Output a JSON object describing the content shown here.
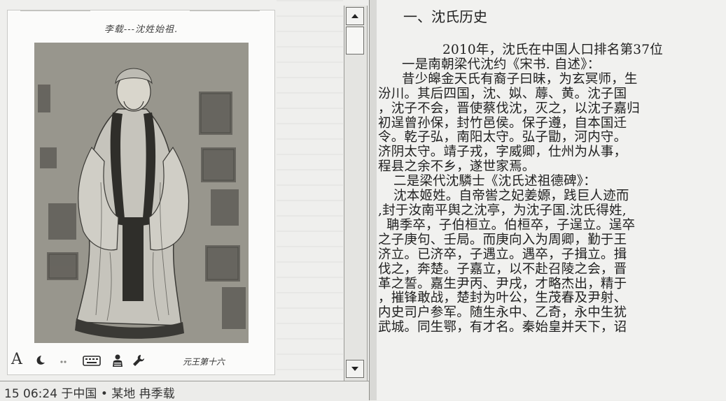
{
  "image_card": {
    "caption": "李载---沈姓始祖.",
    "signature": "元王第十六",
    "tools": {
      "text_tool": "A"
    }
  },
  "article": {
    "heading": "一、沈氏历史",
    "lines": [
      "2010年，沈氏在中国人口排名第37位",
      "一是南朝梁代沈约《宋书. 自述》：",
      "昔少皞金天氏有裔子曰昧，为玄冥师，生",
      "汾川。其后四国，沈、姒、蓐、黄。沈子国",
      "，沈子不会，晋使蔡伐沈，灭之，以沈子嘉归",
      "初逞曾孙保，封竹邑侯。保子遵，自本国迁",
      "令。乾子弘，南阳太守。弘子勖，河内守。",
      "济阴太守。靖子戎，字威卿，仕州为从事，",
      "程县之余不乡，遂世家焉。",
      "二是梁代沈驎士《沈氏述祖德碑》：",
      "沈本姬姓。自帝喾之妃姜嫄，践巨人迹而",
      ",封于汝南平舆之沈亭，为沈子国.沈氏得姓,",
      "聃季卒，子伯桓立。伯桓卒，子逞立。逞卒",
      "之子庚句、壬局。而庚向入为周卿，勤于王",
      "济立。已济卒，子遇立。遇卒，子揖立。揖",
      "伐之，奔楚。子嘉立，以不赴召陵之会，晋",
      "革之誓。嘉生尹丙、尹戌，才略杰出，精于",
      "，摧锋敢战，楚封为叶公，生茂春及尹射、",
      "内史司户参军。随生永中、乙奇，永中生犹",
      "武城。同生鄂，有才名。秦始皇并天下，诏"
    ]
  },
  "status_bar": {
    "text": "15 06:24 于中国 • 某地 冉季载"
  },
  "colors": {
    "page_bg": "#eeeeec",
    "text": "#1f1f1f",
    "card_bg": "#fbfbfa",
    "portrait_bg": "#9c9a92"
  }
}
